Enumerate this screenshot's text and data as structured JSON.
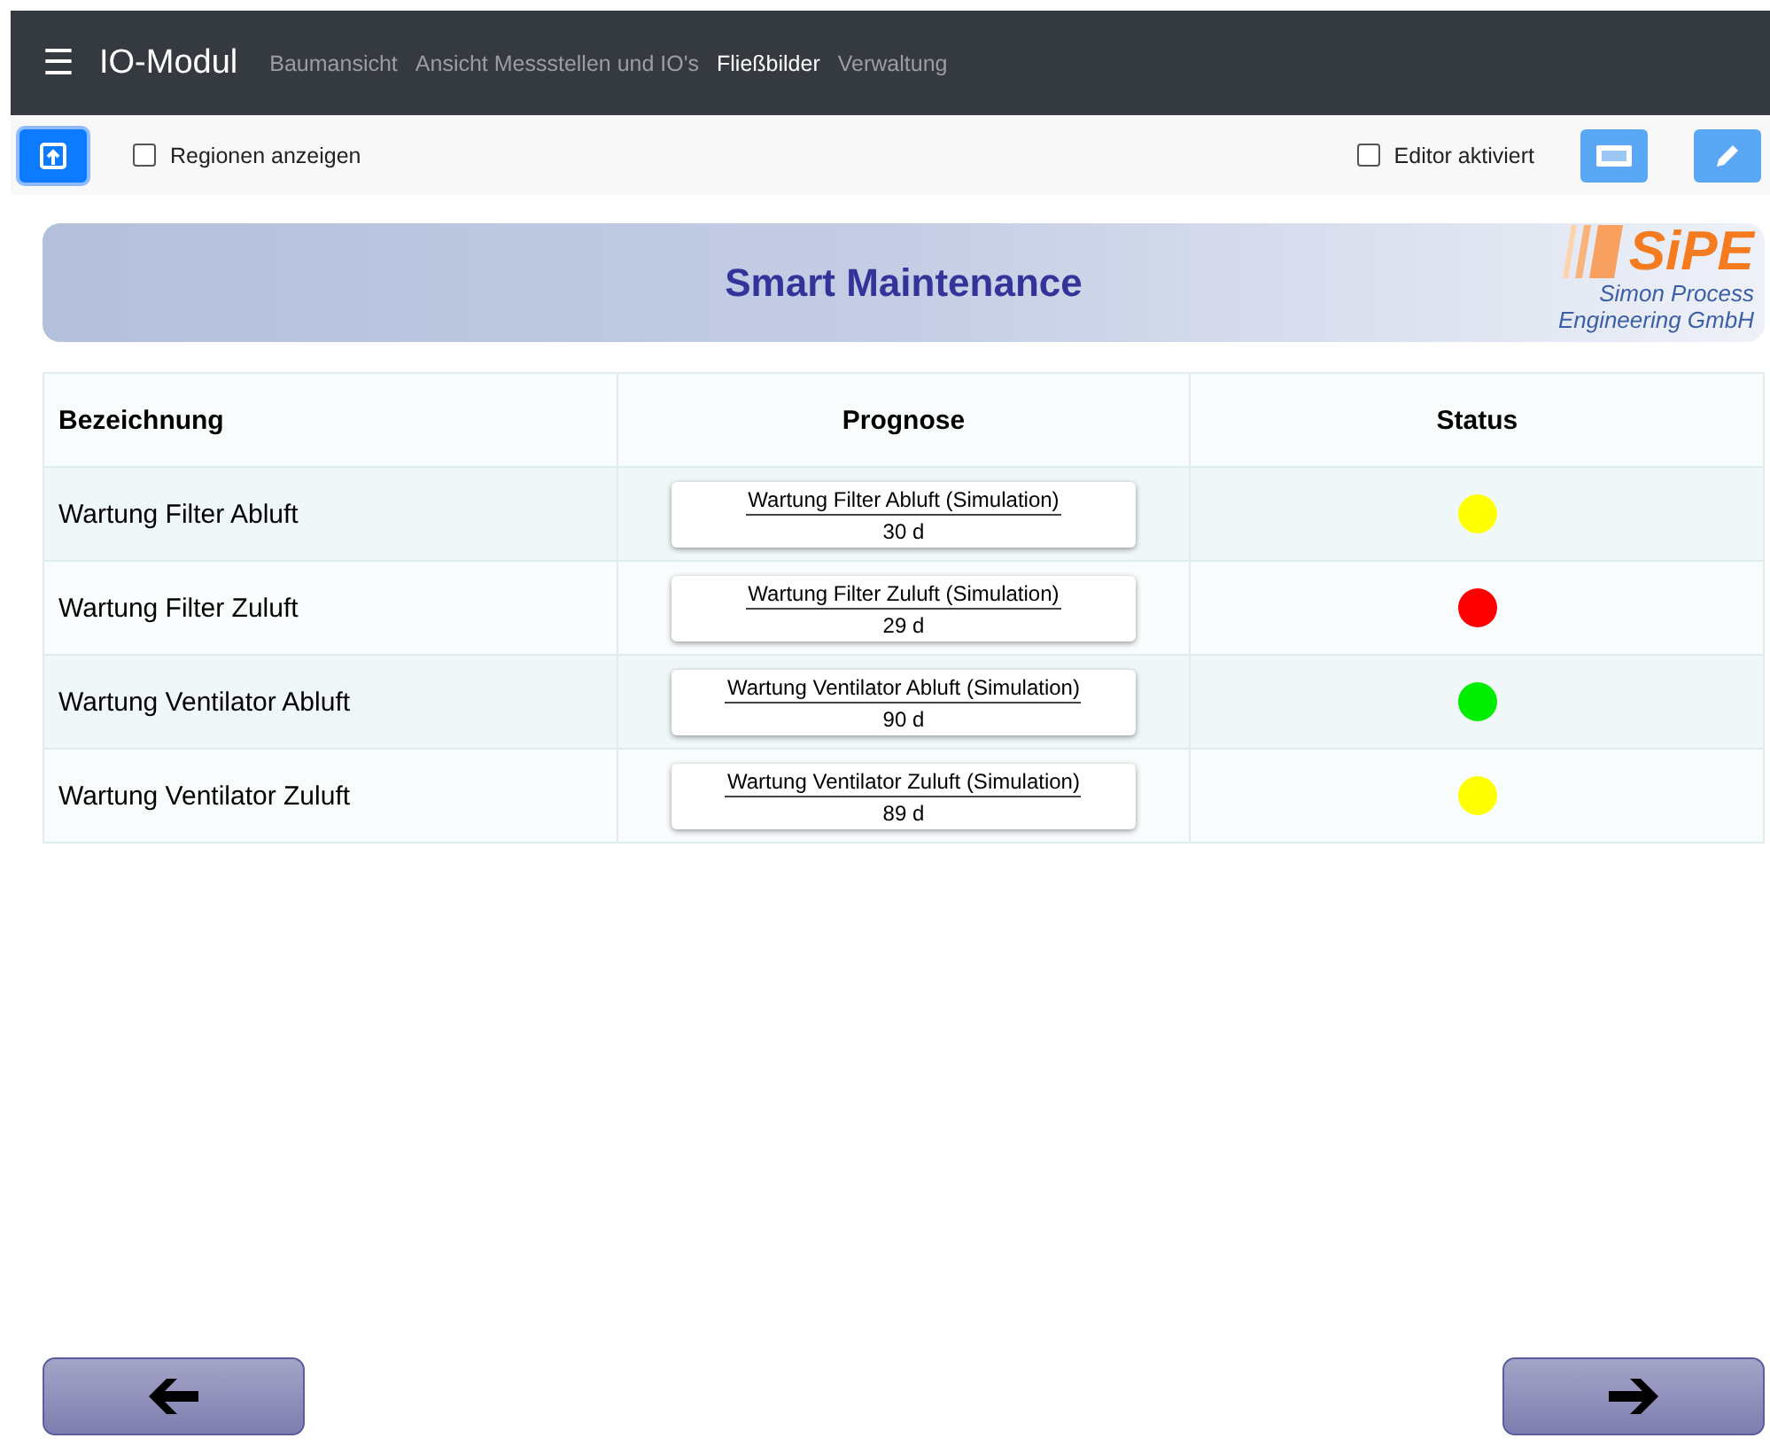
{
  "app_bar": {
    "menu_icon": "☰",
    "title": "IO-Modul",
    "nav": [
      {
        "label": "Baumansicht",
        "selected": false
      },
      {
        "label": "Ansicht Messstellen und IO's",
        "selected": false
      },
      {
        "label": "Fließbilder",
        "selected": true
      },
      {
        "label": "Verwaltung",
        "selected": false
      }
    ]
  },
  "toolbar": {
    "regions": {
      "label": "Regionen anzeigen",
      "checked": false
    },
    "editor": {
      "label": "Editor aktiviert",
      "checked": false
    }
  },
  "banner": {
    "title": "Smart Maintenance",
    "logo": {
      "mark": "SiPE",
      "line_1": "Simon Process",
      "line_2": "Engineering GmbH"
    }
  },
  "table": {
    "columns": [
      "Bezeichnung",
      "Prognose",
      "Status"
    ],
    "rows": [
      {
        "name": "Wartung Filter Abluft",
        "forecast_title": "Wartung Filter Abluft (Simulation)",
        "forecast_value": "30 d",
        "color": "#ffff00"
      },
      {
        "name": "Wartung Filter Zuluft",
        "forecast_title": "Wartung Filter Zuluft (Simulation)",
        "forecast_value": "29 d",
        "color": "#ff0000"
      },
      {
        "name": "Wartung Ventilator Abluft",
        "forecast_title": "Wartung Ventilator Abluft (Simulation)",
        "forecast_value": "90 d",
        "color": "#00ee00"
      },
      {
        "name": "Wartung Ventilator Zuluft",
        "forecast_title": "Wartung Ventilator Zuluft (Simulation)",
        "forecast_value": "89 d",
        "color": "#ffff00"
      }
    ]
  }
}
